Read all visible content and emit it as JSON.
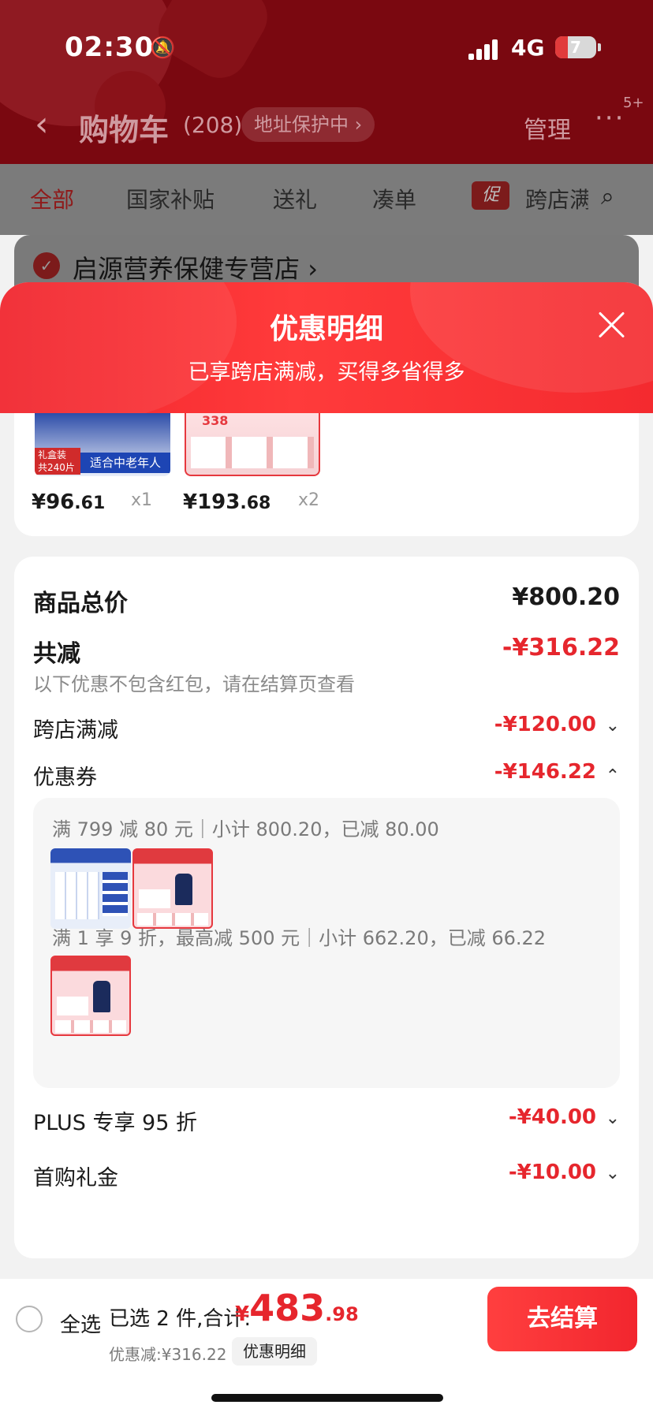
{
  "status_bar": {
    "time": "02:30",
    "network": "4G",
    "battery": "7"
  },
  "header": {
    "back_glyph": "‹",
    "title": "购物车",
    "count": "(208)",
    "address": "地址保护中 ›",
    "manage": "管理",
    "more": "···",
    "badge": "5+"
  },
  "tabs": [
    "全部",
    "国家补贴",
    "送礼",
    "凑单",
    "跨店满"
  ],
  "promo_tag": "促",
  "shop": {
    "name": "启源营养保健专营店",
    "arrow": "›"
  },
  "sheet": {
    "title": "优惠明细",
    "subtitle": "已享跨店满减，买得多省得多"
  },
  "products": [
    {
      "price_int": "¥96",
      "price_dec": ".61",
      "qty": "x1",
      "tag1": "礼盒装\n共240片",
      "tag2": "适合中老年人"
    },
    {
      "price_int": "¥193",
      "price_dec": ".68",
      "qty": "x2",
      "label": "338"
    }
  ],
  "summary": {
    "total_label": "商品总价",
    "total_value": "¥800.20",
    "reduce_label": "共减",
    "reduce_value": "-¥316.22",
    "note": "以下优惠不包含红包，请在结算页查看",
    "cross_label": "跨店满减",
    "cross_value": "-¥120.00",
    "coupon_label": "优惠券",
    "coupon_value": "-¥146.22",
    "plus_label": "PLUS 专享 95 折",
    "plus_value": "-¥40.00",
    "first_label": "首购礼金",
    "first_value": "-¥10.00"
  },
  "coupons": [
    {
      "text": "满 799 减 80 元｜小计 800.20，已减 80.00"
    },
    {
      "text": "满 1 享 9 折，最高减 500 元｜小计 662.20，已减 66.22"
    }
  ],
  "bottom_bar": {
    "select_all": "全选",
    "selected": "已选 2 件,合计:",
    "currency": "¥",
    "total_int": "483",
    "total_dec": ".98",
    "discount": "优惠减:¥316.22",
    "detail": "优惠明细",
    "checkout": "去结算"
  },
  "colors": {
    "accent": "#e6262d",
    "header_bg": "#7a0810",
    "sheet_head": "#f1232c"
  }
}
